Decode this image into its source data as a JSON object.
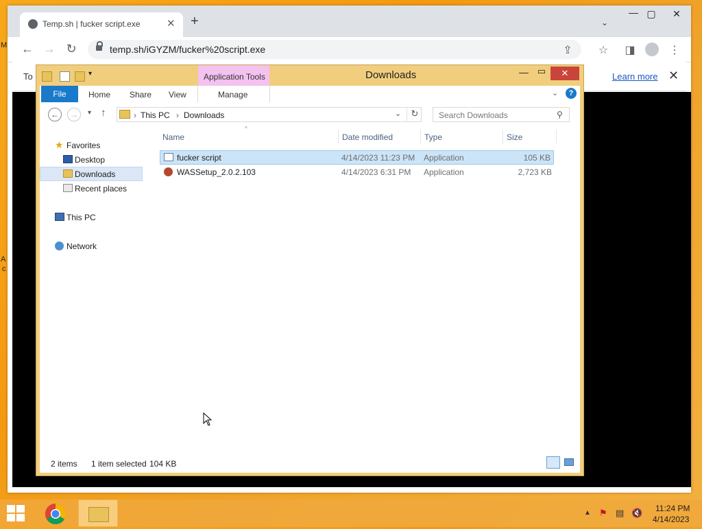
{
  "desktop": {
    "fragments": [
      "M",
      "A",
      "c"
    ]
  },
  "chrome": {
    "tab_title": "Temp.sh | fucker script.exe",
    "url": "temp.sh/iGYZM/fucker%20script.exe",
    "new_tab_glyph": "+",
    "infobar_text": "To",
    "learn_more": "Learn more",
    "icons": [
      "globe-icon",
      "close-icon",
      "plus-icon",
      "back-icon",
      "forward-icon",
      "reload-icon",
      "lock-icon",
      "share-icon",
      "star-icon",
      "sidebar-icon",
      "profile-icon",
      "menu-icon"
    ]
  },
  "explorer": {
    "title": "Downloads",
    "context_tab": "Application Tools",
    "ribbon_tabs": {
      "file": "File",
      "home": "Home",
      "share": "Share",
      "view": "View",
      "manage": "Manage"
    },
    "breadcrumb": [
      "This PC",
      "Downloads"
    ],
    "search_placeholder": "Search Downloads",
    "nav": {
      "favorites": "Favorites",
      "desktop": "Desktop",
      "downloads": "Downloads",
      "recent": "Recent places",
      "this_pc": "This PC",
      "network": "Network"
    },
    "columns": {
      "name": "Name",
      "date": "Date modified",
      "type": "Type",
      "size": "Size"
    },
    "files": [
      {
        "name": "fucker script",
        "date": "4/14/2023 11:23 PM",
        "type": "Application",
        "size": "105 KB",
        "selected": true
      },
      {
        "name": "WASSetup_2.0.2.103",
        "date": "4/14/2023 6:31 PM",
        "type": "Application",
        "size": "2,723 KB",
        "selected": false
      }
    ],
    "status": {
      "count": "2 items",
      "selected": "1 item selected",
      "size": "104 KB"
    },
    "accent_color": "#1979ca",
    "frame_color": "#f1ce7e"
  },
  "taskbar": {
    "time": "11:24 PM",
    "date": "4/14/2023"
  }
}
